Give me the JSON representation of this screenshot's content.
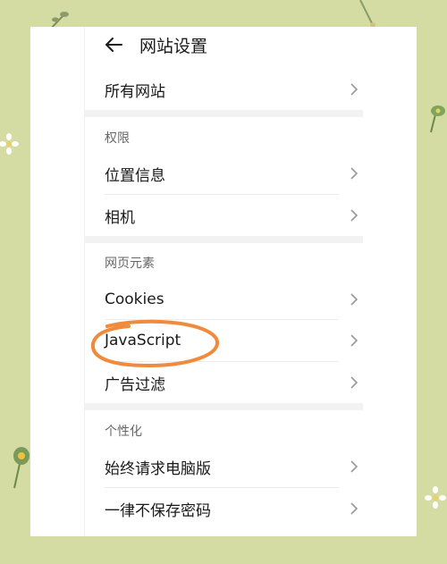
{
  "header": {
    "back_icon": "arrow-left-icon",
    "title": "网站设置"
  },
  "rows": {
    "all_sites": "所有网站",
    "location": "位置信息",
    "camera": "相机",
    "cookies": "Cookies",
    "javascript": "JavaScript",
    "ad_filter": "广告过滤",
    "always_desktop": "始终请求电脑版",
    "never_save_password": "一律不保存密码"
  },
  "sections": {
    "permissions": "权限",
    "page_elements": "网页元素",
    "personalization": "个性化"
  },
  "colors": {
    "background": "#d4dca4",
    "card": "#ffffff",
    "highlight": "#f08a3c",
    "text": "#1a1a1a",
    "muted": "#666666"
  },
  "icons": {
    "chevron": "chevron-right-icon"
  }
}
